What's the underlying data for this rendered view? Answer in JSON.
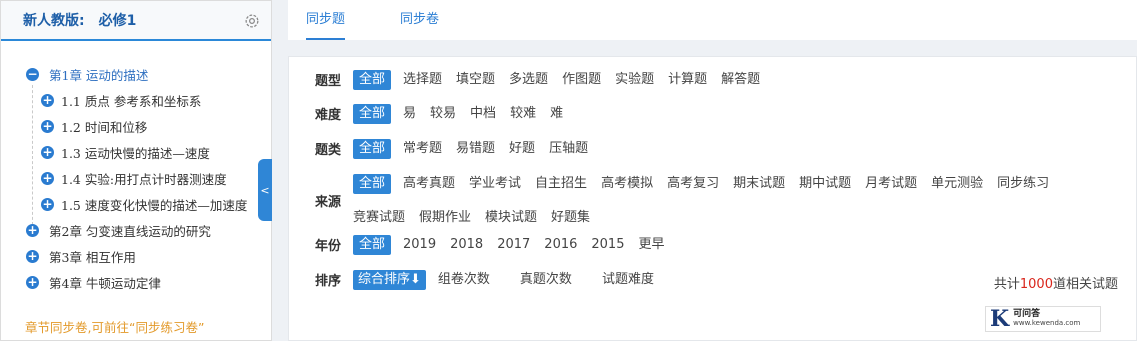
{
  "sidebar": {
    "edition": "新人教版:",
    "book": "必修1",
    "tree": [
      {
        "label": "第1章 运动的描述",
        "icon": "minus"
      },
      {
        "label": "1.1 质点 参考系和坐标系",
        "icon": "plus"
      },
      {
        "label": "1.2 时间和位移",
        "icon": "plus"
      },
      {
        "label": "1.3 运动快慢的描述—速度",
        "icon": "plus"
      },
      {
        "label": "1.4 实验:用打点计时器测速度",
        "icon": "plus"
      },
      {
        "label": "1.5 速度变化快慢的描述—加速度",
        "icon": "plus"
      },
      {
        "label": "第2章 匀变速直线运动的研究",
        "icon": "plus"
      },
      {
        "label": "第3章 相互作用",
        "icon": "plus"
      },
      {
        "label": "第4章 牛顿运动定律",
        "icon": "plus"
      }
    ],
    "footer": "章节同步卷,可前往“同步练习卷”",
    "collapse_glyph": "<"
  },
  "tabs": [
    "同步题",
    "同步卷"
  ],
  "filters": {
    "type": {
      "label": "题型",
      "options": [
        "全部",
        "选择题",
        "填空题",
        "多选题",
        "作图题",
        "实验题",
        "计算题",
        "解答题"
      ]
    },
    "difficulty": {
      "label": "难度",
      "options": [
        "全部",
        "易",
        "较易",
        "中档",
        "较难",
        "难"
      ]
    },
    "category": {
      "label": "题类",
      "options": [
        "全部",
        "常考题",
        "易错题",
        "好题",
        "压轴题"
      ]
    },
    "source": {
      "label": "来源",
      "options": [
        "全部",
        "高考真题",
        "学业考试",
        "自主招生",
        "高考模拟",
        "高考复习",
        "期末试题",
        "期中试题",
        "月考试题",
        "单元测验",
        "同步练习",
        "竞赛试题",
        "假期作业",
        "模块试题",
        "好题集"
      ]
    },
    "year": {
      "label": "年份",
      "options": [
        "全部",
        "2019",
        "2018",
        "2017",
        "2016",
        "2015",
        "更早"
      ]
    },
    "sort": {
      "label": "排序",
      "options": [
        "综合排序⬇",
        "组卷次数",
        "真题次数",
        "试题难度"
      ]
    }
  },
  "total": {
    "prefix": "共计",
    "count": "1000",
    "suffix": "道相关试题"
  },
  "watermark": {
    "logo": "K",
    "name": "可问答",
    "url": "www.kewenda.com"
  },
  "colors": {
    "accent": "#2f86d6",
    "count": "#d9261c",
    "footer_link": "#e39a2b"
  }
}
